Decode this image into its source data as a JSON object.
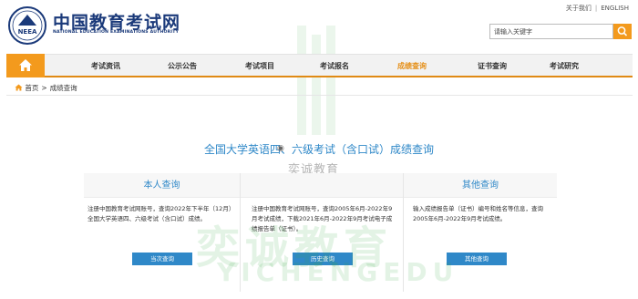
{
  "header": {
    "site_title": "中国教育考试网",
    "site_subtitle": "NATIONAL EDUCATION EXAMINATIONS AUTHORITY",
    "logo_text": "NEEA",
    "about_link": "关于我们",
    "english_link": "ENGLISH",
    "search_placeholder": "请输入关键字"
  },
  "nav": {
    "items": [
      {
        "label": "考试资讯"
      },
      {
        "label": "公示公告"
      },
      {
        "label": "考试项目"
      },
      {
        "label": "考试报名"
      },
      {
        "label": "成绩查询"
      },
      {
        "label": "证书查询"
      },
      {
        "label": "考试研究"
      }
    ],
    "active_color": "#e5901a"
  },
  "breadcrumb": {
    "home": "首页",
    "separator": ">",
    "current": "成绩查询"
  },
  "main": {
    "title": "全国大学英语四、六级考试（含口试）成绩查询",
    "panels": [
      {
        "title": "本人查询",
        "description": "注册中国教育考试网账号，查询2022年下半年（12月）全国大学英语四、六级考试（含口试）成绩。",
        "button": "当次查询"
      },
      {
        "title": "",
        "description": "注册中国教育考试网账号，查询2005年6月-2022年9月考试成绩，下载2021年6月-2022年9月考试电子成绩报告单（证书）。",
        "button": "历史查询"
      },
      {
        "title": "其他查询",
        "description": "输入成绩报告单（证书）编号和姓名等信息，查询2005年6月-2022年9月考试成绩。",
        "button": "其他查询"
      }
    ]
  },
  "watermark": {
    "brand": "奕诚教育",
    "big": "奕诚教育",
    "latin": "YICHENGEDU"
  },
  "colors": {
    "accent": "#f39a1d",
    "link_blue": "#2f88c8",
    "brand_navy": "#1b3a7a"
  }
}
